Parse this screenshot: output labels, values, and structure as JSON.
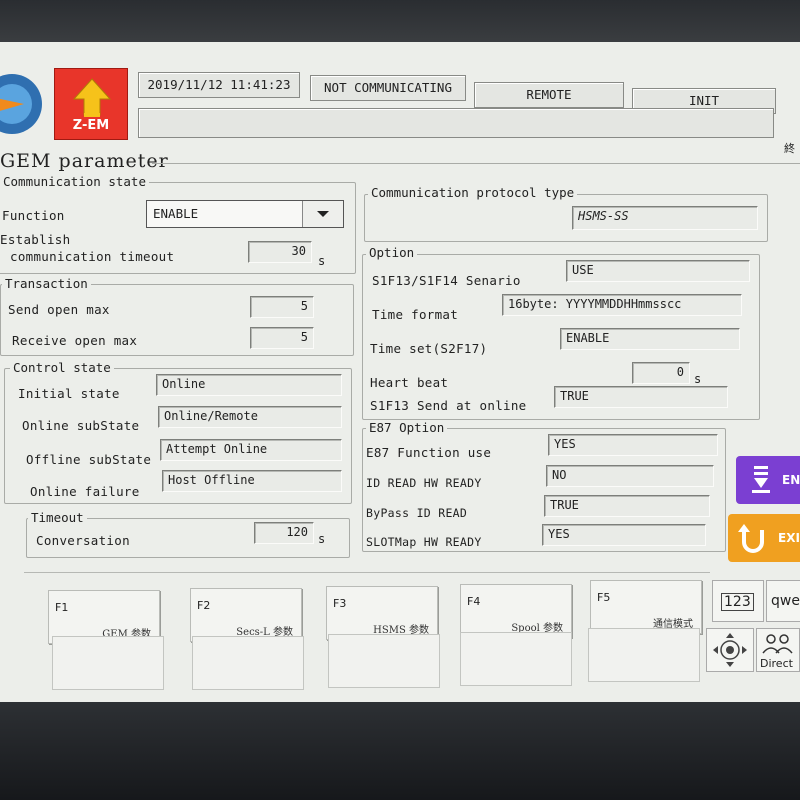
{
  "header": {
    "datetime": "2019/11/12 11:41:23",
    "comm_status": "NOT COMMUNICATING",
    "mode": "REMOTE",
    "state": "INIT",
    "zem_label": "Z-EM",
    "corner_text": "終"
  },
  "page_title": "GEM parameter",
  "communication_state": {
    "title": "Communication state",
    "function_label": "Function",
    "function_value": "ENABLE",
    "establish_label_1": "Establish",
    "establish_label_2": "communication timeout",
    "establish_value": "30",
    "establish_unit": "s"
  },
  "transaction": {
    "title": "Transaction",
    "send_open_label": "Send open max",
    "send_open_value": "5",
    "receive_open_label": "Receive open max",
    "receive_open_value": "5"
  },
  "control_state": {
    "title": "Control state",
    "initial_label": "Initial state",
    "initial_value": "Online",
    "online_sub_label": "Online subState",
    "online_sub_value": "Online/Remote",
    "offline_sub_label": "Offline subState",
    "offline_sub_value": "Attempt Online",
    "online_failure_label": "Online failure",
    "online_failure_value": "Host Offline"
  },
  "timeout": {
    "title": "Timeout",
    "conversation_label": "Conversation",
    "conversation_value": "120",
    "conversation_unit": "s"
  },
  "protocol": {
    "title": "Communication protocol type",
    "value": "HSMS-SS"
  },
  "option": {
    "title": "Option",
    "scenario_label": "S1F13/S1F14 Senario",
    "scenario_value": "USE",
    "time_format_label": "Time format",
    "time_format_value": "16byte: YYYYMMDDHHmmsscc",
    "time_set_label": "Time set(S2F17)",
    "time_set_value": "ENABLE",
    "heart_beat_label": "Heart beat",
    "heart_beat_value": "0",
    "heart_beat_unit": "s",
    "s1f13_label": "S1F13 Send at online",
    "s1f13_value": "TRUE"
  },
  "e87": {
    "title": "E87 Option",
    "function_use_label": "E87 Function use",
    "function_use_value": "YES",
    "id_read_label": "ID READ HW READY",
    "id_read_value": "NO",
    "bypass_label": "ByPass ID READ",
    "bypass_value": "TRUE",
    "slotmap_label": "SLOTMap HW READY",
    "slotmap_value": "YES"
  },
  "fkeys": [
    {
      "num": "F1",
      "name": "GEM 参数"
    },
    {
      "num": "F2",
      "name": "Secs-L 参数"
    },
    {
      "num": "F3",
      "name": "HSMS 参数"
    },
    {
      "num": "F4",
      "name": "Spool 参数"
    },
    {
      "num": "F5",
      "name": "通信模式"
    }
  ],
  "side": {
    "enter_label": "EN",
    "exit_label": "EXI",
    "numeric_label": "123",
    "qwerty_label": "qwe",
    "direct_label": "Direct"
  },
  "colors": {
    "screen_bg": "#eceeea",
    "zem_red": "#e8352a",
    "enter_purple": "#7b3fd2",
    "exit_orange": "#f0a020"
  }
}
